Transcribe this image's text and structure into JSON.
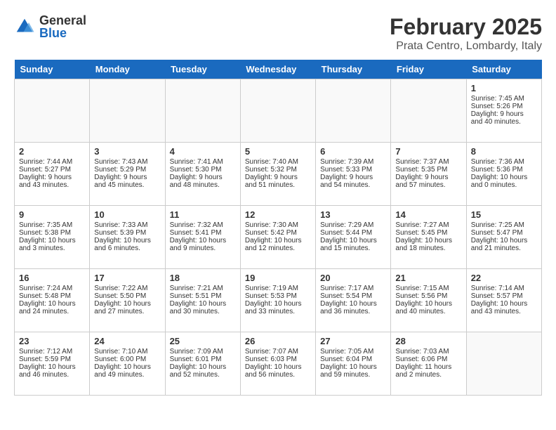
{
  "logo": {
    "general": "General",
    "blue": "Blue"
  },
  "title": "February 2025",
  "subtitle": "Prata Centro, Lombardy, Italy",
  "weekdays": [
    "Sunday",
    "Monday",
    "Tuesday",
    "Wednesday",
    "Thursday",
    "Friday",
    "Saturday"
  ],
  "weeks": [
    [
      {
        "day": "",
        "content": ""
      },
      {
        "day": "",
        "content": ""
      },
      {
        "day": "",
        "content": ""
      },
      {
        "day": "",
        "content": ""
      },
      {
        "day": "",
        "content": ""
      },
      {
        "day": "",
        "content": ""
      },
      {
        "day": "1",
        "content": "Sunrise: 7:45 AM\nSunset: 5:26 PM\nDaylight: 9 hours and 40 minutes."
      }
    ],
    [
      {
        "day": "2",
        "content": "Sunrise: 7:44 AM\nSunset: 5:27 PM\nDaylight: 9 hours and 43 minutes."
      },
      {
        "day": "3",
        "content": "Sunrise: 7:43 AM\nSunset: 5:29 PM\nDaylight: 9 hours and 45 minutes."
      },
      {
        "day": "4",
        "content": "Sunrise: 7:41 AM\nSunset: 5:30 PM\nDaylight: 9 hours and 48 minutes."
      },
      {
        "day": "5",
        "content": "Sunrise: 7:40 AM\nSunset: 5:32 PM\nDaylight: 9 hours and 51 minutes."
      },
      {
        "day": "6",
        "content": "Sunrise: 7:39 AM\nSunset: 5:33 PM\nDaylight: 9 hours and 54 minutes."
      },
      {
        "day": "7",
        "content": "Sunrise: 7:37 AM\nSunset: 5:35 PM\nDaylight: 9 hours and 57 minutes."
      },
      {
        "day": "8",
        "content": "Sunrise: 7:36 AM\nSunset: 5:36 PM\nDaylight: 10 hours and 0 minutes."
      }
    ],
    [
      {
        "day": "9",
        "content": "Sunrise: 7:35 AM\nSunset: 5:38 PM\nDaylight: 10 hours and 3 minutes."
      },
      {
        "day": "10",
        "content": "Sunrise: 7:33 AM\nSunset: 5:39 PM\nDaylight: 10 hours and 6 minutes."
      },
      {
        "day": "11",
        "content": "Sunrise: 7:32 AM\nSunset: 5:41 PM\nDaylight: 10 hours and 9 minutes."
      },
      {
        "day": "12",
        "content": "Sunrise: 7:30 AM\nSunset: 5:42 PM\nDaylight: 10 hours and 12 minutes."
      },
      {
        "day": "13",
        "content": "Sunrise: 7:29 AM\nSunset: 5:44 PM\nDaylight: 10 hours and 15 minutes."
      },
      {
        "day": "14",
        "content": "Sunrise: 7:27 AM\nSunset: 5:45 PM\nDaylight: 10 hours and 18 minutes."
      },
      {
        "day": "15",
        "content": "Sunrise: 7:25 AM\nSunset: 5:47 PM\nDaylight: 10 hours and 21 minutes."
      }
    ],
    [
      {
        "day": "16",
        "content": "Sunrise: 7:24 AM\nSunset: 5:48 PM\nDaylight: 10 hours and 24 minutes."
      },
      {
        "day": "17",
        "content": "Sunrise: 7:22 AM\nSunset: 5:50 PM\nDaylight: 10 hours and 27 minutes."
      },
      {
        "day": "18",
        "content": "Sunrise: 7:21 AM\nSunset: 5:51 PM\nDaylight: 10 hours and 30 minutes."
      },
      {
        "day": "19",
        "content": "Sunrise: 7:19 AM\nSunset: 5:53 PM\nDaylight: 10 hours and 33 minutes."
      },
      {
        "day": "20",
        "content": "Sunrise: 7:17 AM\nSunset: 5:54 PM\nDaylight: 10 hours and 36 minutes."
      },
      {
        "day": "21",
        "content": "Sunrise: 7:15 AM\nSunset: 5:56 PM\nDaylight: 10 hours and 40 minutes."
      },
      {
        "day": "22",
        "content": "Sunrise: 7:14 AM\nSunset: 5:57 PM\nDaylight: 10 hours and 43 minutes."
      }
    ],
    [
      {
        "day": "23",
        "content": "Sunrise: 7:12 AM\nSunset: 5:59 PM\nDaylight: 10 hours and 46 minutes."
      },
      {
        "day": "24",
        "content": "Sunrise: 7:10 AM\nSunset: 6:00 PM\nDaylight: 10 hours and 49 minutes."
      },
      {
        "day": "25",
        "content": "Sunrise: 7:09 AM\nSunset: 6:01 PM\nDaylight: 10 hours and 52 minutes."
      },
      {
        "day": "26",
        "content": "Sunrise: 7:07 AM\nSunset: 6:03 PM\nDaylight: 10 hours and 56 minutes."
      },
      {
        "day": "27",
        "content": "Sunrise: 7:05 AM\nSunset: 6:04 PM\nDaylight: 10 hours and 59 minutes."
      },
      {
        "day": "28",
        "content": "Sunrise: 7:03 AM\nSunset: 6:06 PM\nDaylight: 11 hours and 2 minutes."
      },
      {
        "day": "",
        "content": ""
      }
    ]
  ]
}
